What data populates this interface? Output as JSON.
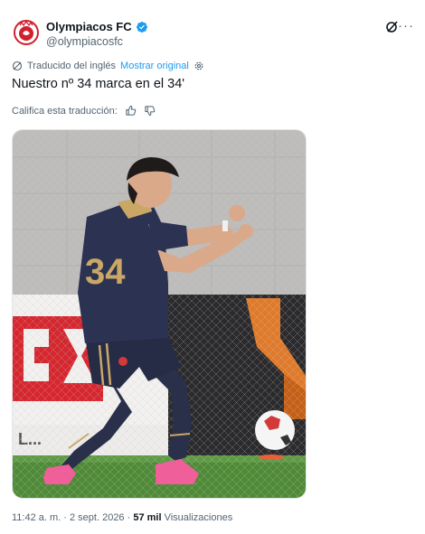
{
  "account": {
    "name": "Olympiacos FC",
    "handle": "@olympiacosfc"
  },
  "translation": {
    "label": "Traducido del inglés",
    "show_original": "Mostrar original"
  },
  "tweet": {
    "text": "Nuestro nº 34 marca en el 34'"
  },
  "rating": {
    "label": "Califica esta traducción:"
  },
  "media": {
    "alt": "Jugador celebrando un gol",
    "jersey_number": "34"
  },
  "meta": {
    "time": "11:42 a. m.",
    "separator": " · ",
    "date": "2 sept. 2026",
    "separator2": " · ",
    "views_count": "57 mil",
    "views_label": " Visualizaciones"
  },
  "colors": {
    "accent": "#1d9bf0",
    "secondary_text": "#536471",
    "primary_text": "#0f1419",
    "olympiacos_red": "#d0202e"
  },
  "icons": {
    "verified": "verified-badge-icon",
    "grok": "grok-icon",
    "more": "more-options-icon",
    "translate": "translate-icon",
    "settings": "gear-icon",
    "thumbs_up": "thumbs-up-icon",
    "thumbs_down": "thumbs-down-icon"
  }
}
